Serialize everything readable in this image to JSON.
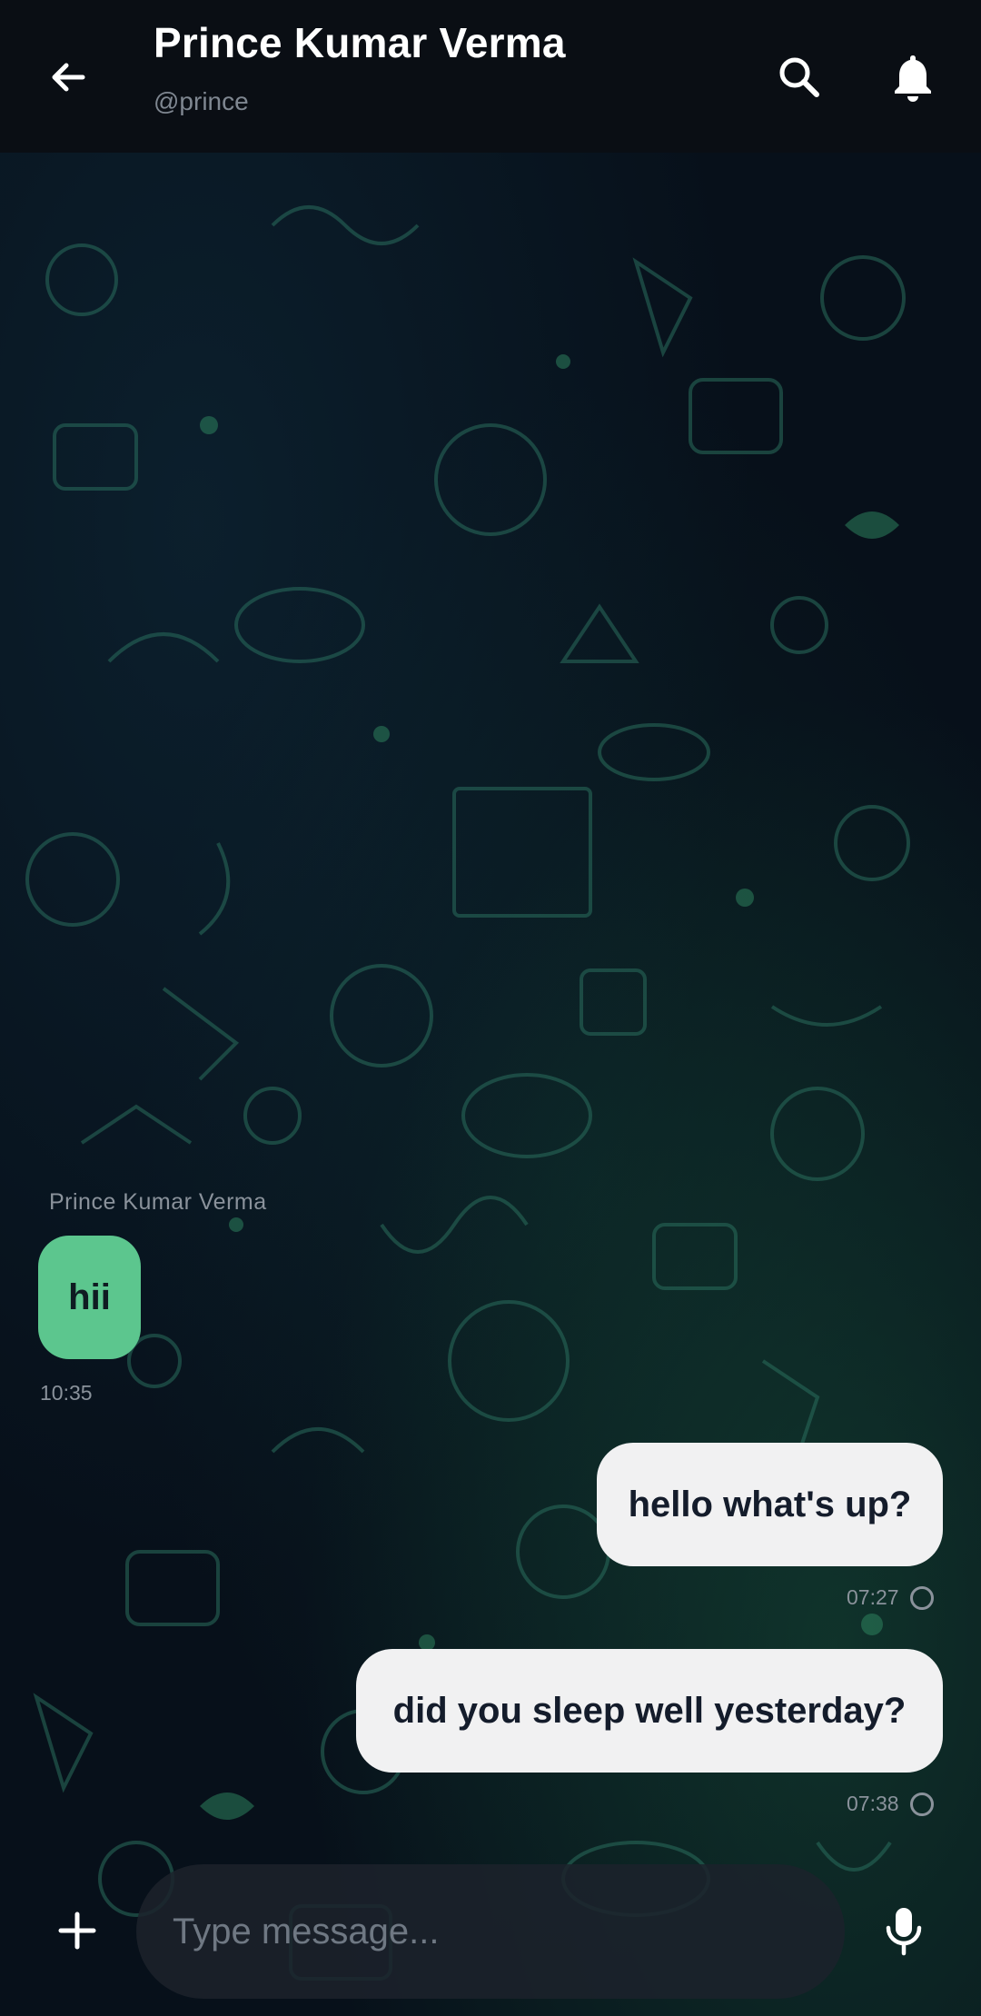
{
  "header": {
    "title": "Prince Kumar Verma",
    "handle": "@prince",
    "icons": [
      "arrow-back-icon",
      "search-icon",
      "bell-icon"
    ]
  },
  "messages": [
    {
      "direction": "incoming",
      "sender": "Prince Kumar Verma",
      "text": "hii",
      "time": "10:35"
    },
    {
      "direction": "outgoing",
      "text": "hello what's up?",
      "time": "07:27",
      "status": "pending"
    },
    {
      "direction": "outgoing",
      "text": "did you sleep well yesterday?",
      "time": "07:38",
      "status": "pending"
    }
  ],
  "composer": {
    "placeholder": "Type message...",
    "value": "",
    "icons": [
      "plus-icon",
      "microphone-icon"
    ]
  },
  "colors": {
    "header_bg": "#0a0e14",
    "incoming_bubble": "#5cc68e",
    "outgoing_bubble": "#f1f1f2",
    "wallpaper_doodle": "#2f7f68"
  }
}
